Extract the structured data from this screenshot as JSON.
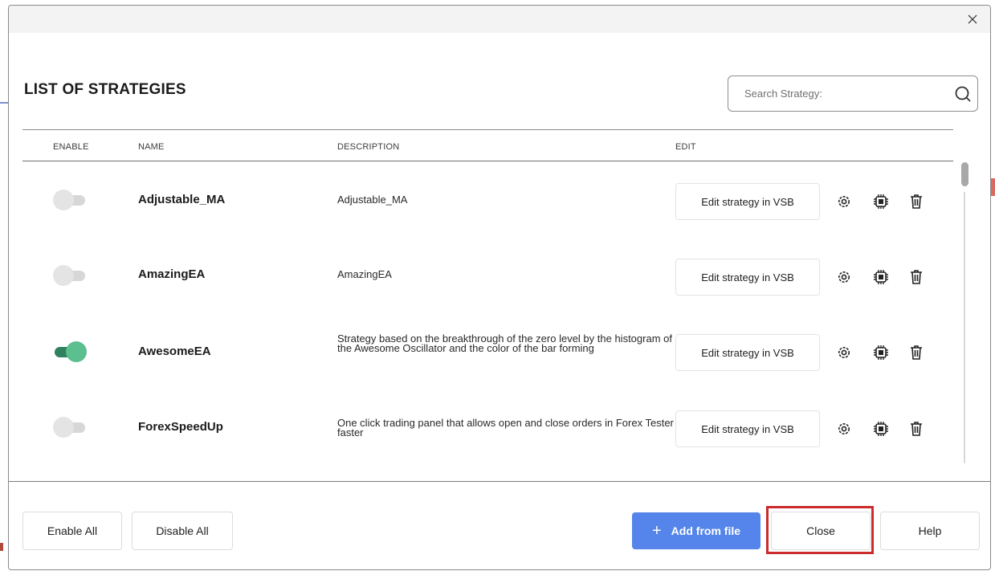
{
  "dialog": {
    "close_glyph": "×",
    "heading": "LIST OF STRATEGIES",
    "search": {
      "placeholder": "Search Strategy:",
      "value": "",
      "icon": "search-icon"
    }
  },
  "table": {
    "columns": [
      "ENABLE",
      "NAME",
      "DESCRIPTION",
      "EDIT"
    ],
    "rows": [
      {
        "enabled": false,
        "name": "Adjustable_MA",
        "description": "Adjustable_MA",
        "edit_label": "Edit strategy in VSB"
      },
      {
        "enabled": false,
        "name": "AmazingEA",
        "description": "AmazingEA",
        "edit_label": "Edit strategy in VSB"
      },
      {
        "enabled": true,
        "name": "AwesomeEA",
        "description": "Strategy based on the breakthrough of the zero level by the histogram of the Awesome Oscillator and the color of the bar forming",
        "edit_label": "Edit strategy in VSB"
      },
      {
        "enabled": false,
        "name": "ForexSpeedUp",
        "description": "One click trading panel that allows open and close orders in Forex Tester faster",
        "edit_label": "Edit strategy in VSB"
      }
    ],
    "row_icons": [
      "settings-gear-icon",
      "ai-chip-icon",
      "trash-icon"
    ]
  },
  "footer": {
    "enable_all": "Enable All",
    "disable_all": "Disable All",
    "add_from_file_plus": "+",
    "add_from_file": "Add from file",
    "close": "Close",
    "help": "Help"
  },
  "colors": {
    "primary": "#5585ea",
    "toggle_on_track": "#2f8160",
    "toggle_on_knob": "#5cbf8f",
    "toggle_off": "#e4e4e4",
    "highlight": "#cc2b2b"
  }
}
